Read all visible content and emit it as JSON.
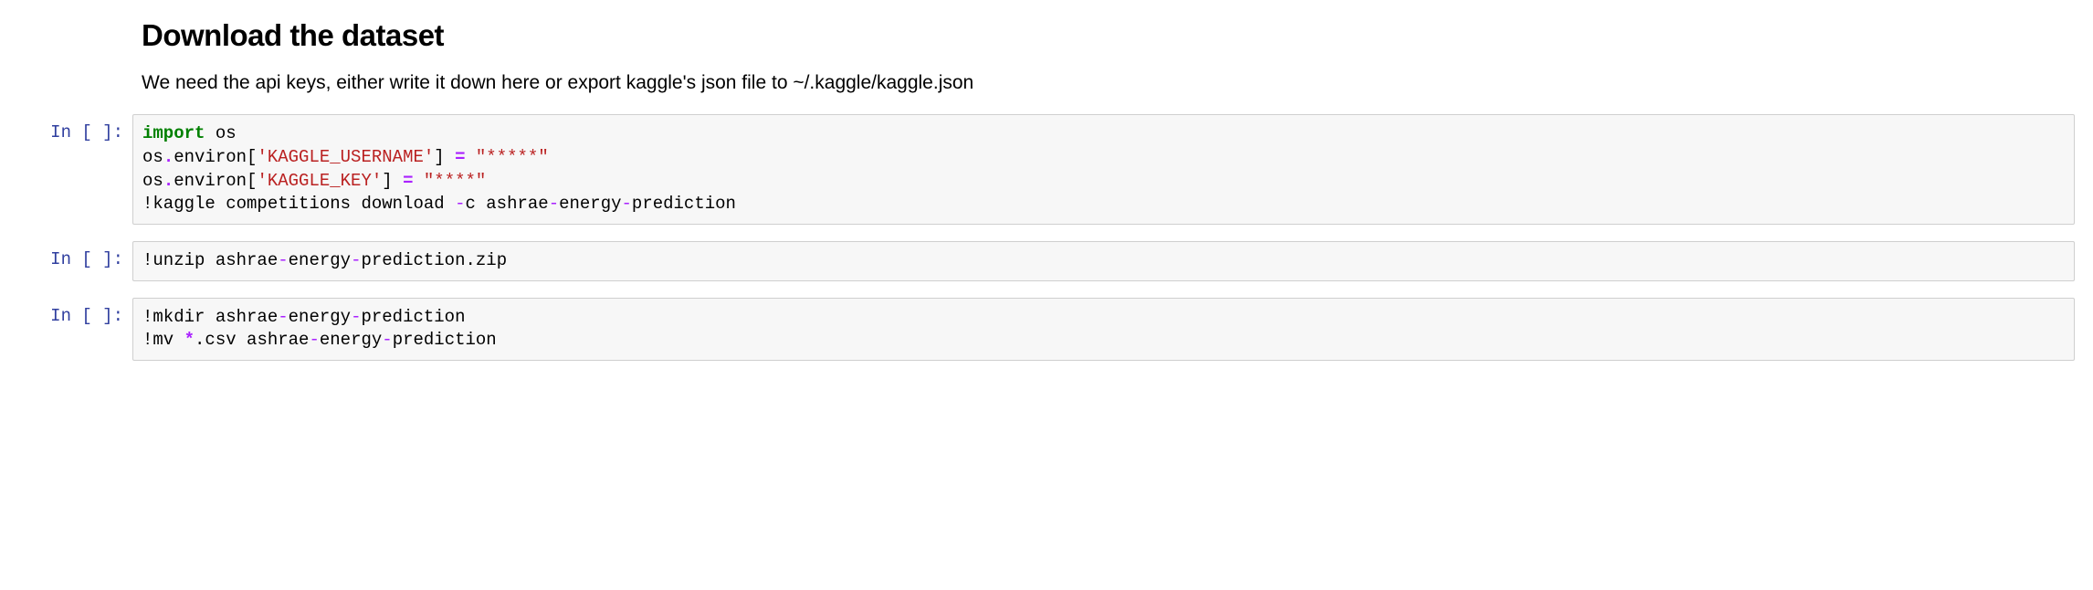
{
  "markdown": {
    "heading": "Download the dataset",
    "body": "We need the api keys, either write it down here or export kaggle's json file to ~/.kaggle/kaggle.json"
  },
  "prompts": {
    "label": "In [ ]:"
  },
  "cells": [
    {
      "tokens": [
        {
          "t": "import",
          "cls": "kw"
        },
        {
          "t": " os\n",
          "cls": "name"
        },
        {
          "t": "os",
          "cls": "name"
        },
        {
          "t": ".",
          "cls": "op"
        },
        {
          "t": "environ[",
          "cls": "name"
        },
        {
          "t": "'KAGGLE_USERNAME'",
          "cls": "str"
        },
        {
          "t": "] ",
          "cls": "name"
        },
        {
          "t": "=",
          "cls": "op"
        },
        {
          "t": " ",
          "cls": "name"
        },
        {
          "t": "\"*****\"",
          "cls": "str"
        },
        {
          "t": "\n",
          "cls": "name"
        },
        {
          "t": "os",
          "cls": "name"
        },
        {
          "t": ".",
          "cls": "op"
        },
        {
          "t": "environ[",
          "cls": "name"
        },
        {
          "t": "'KAGGLE_KEY'",
          "cls": "str"
        },
        {
          "t": "] ",
          "cls": "name"
        },
        {
          "t": "=",
          "cls": "op"
        },
        {
          "t": " ",
          "cls": "name"
        },
        {
          "t": "\"****\"",
          "cls": "str"
        },
        {
          "t": "\n",
          "cls": "name"
        },
        {
          "t": "!",
          "cls": "magic"
        },
        {
          "t": "kaggle competitions download ",
          "cls": "name"
        },
        {
          "t": "-",
          "cls": "dash"
        },
        {
          "t": "c ashrae",
          "cls": "name"
        },
        {
          "t": "-",
          "cls": "dash"
        },
        {
          "t": "energy",
          "cls": "name"
        },
        {
          "t": "-",
          "cls": "dash"
        },
        {
          "t": "prediction",
          "cls": "name"
        }
      ]
    },
    {
      "tokens": [
        {
          "t": "!",
          "cls": "magic"
        },
        {
          "t": "unzip ashrae",
          "cls": "name"
        },
        {
          "t": "-",
          "cls": "dash"
        },
        {
          "t": "energy",
          "cls": "name"
        },
        {
          "t": "-",
          "cls": "dash"
        },
        {
          "t": "prediction.zip",
          "cls": "name"
        }
      ]
    },
    {
      "tokens": [
        {
          "t": "!",
          "cls": "magic"
        },
        {
          "t": "mkdir ashrae",
          "cls": "name"
        },
        {
          "t": "-",
          "cls": "dash"
        },
        {
          "t": "energy",
          "cls": "name"
        },
        {
          "t": "-",
          "cls": "dash"
        },
        {
          "t": "prediction\n",
          "cls": "name"
        },
        {
          "t": "!",
          "cls": "magic"
        },
        {
          "t": "mv ",
          "cls": "name"
        },
        {
          "t": "*",
          "cls": "op"
        },
        {
          "t": ".csv ashrae",
          "cls": "name"
        },
        {
          "t": "-",
          "cls": "dash"
        },
        {
          "t": "energy",
          "cls": "name"
        },
        {
          "t": "-",
          "cls": "dash"
        },
        {
          "t": "prediction",
          "cls": "name"
        }
      ]
    }
  ]
}
